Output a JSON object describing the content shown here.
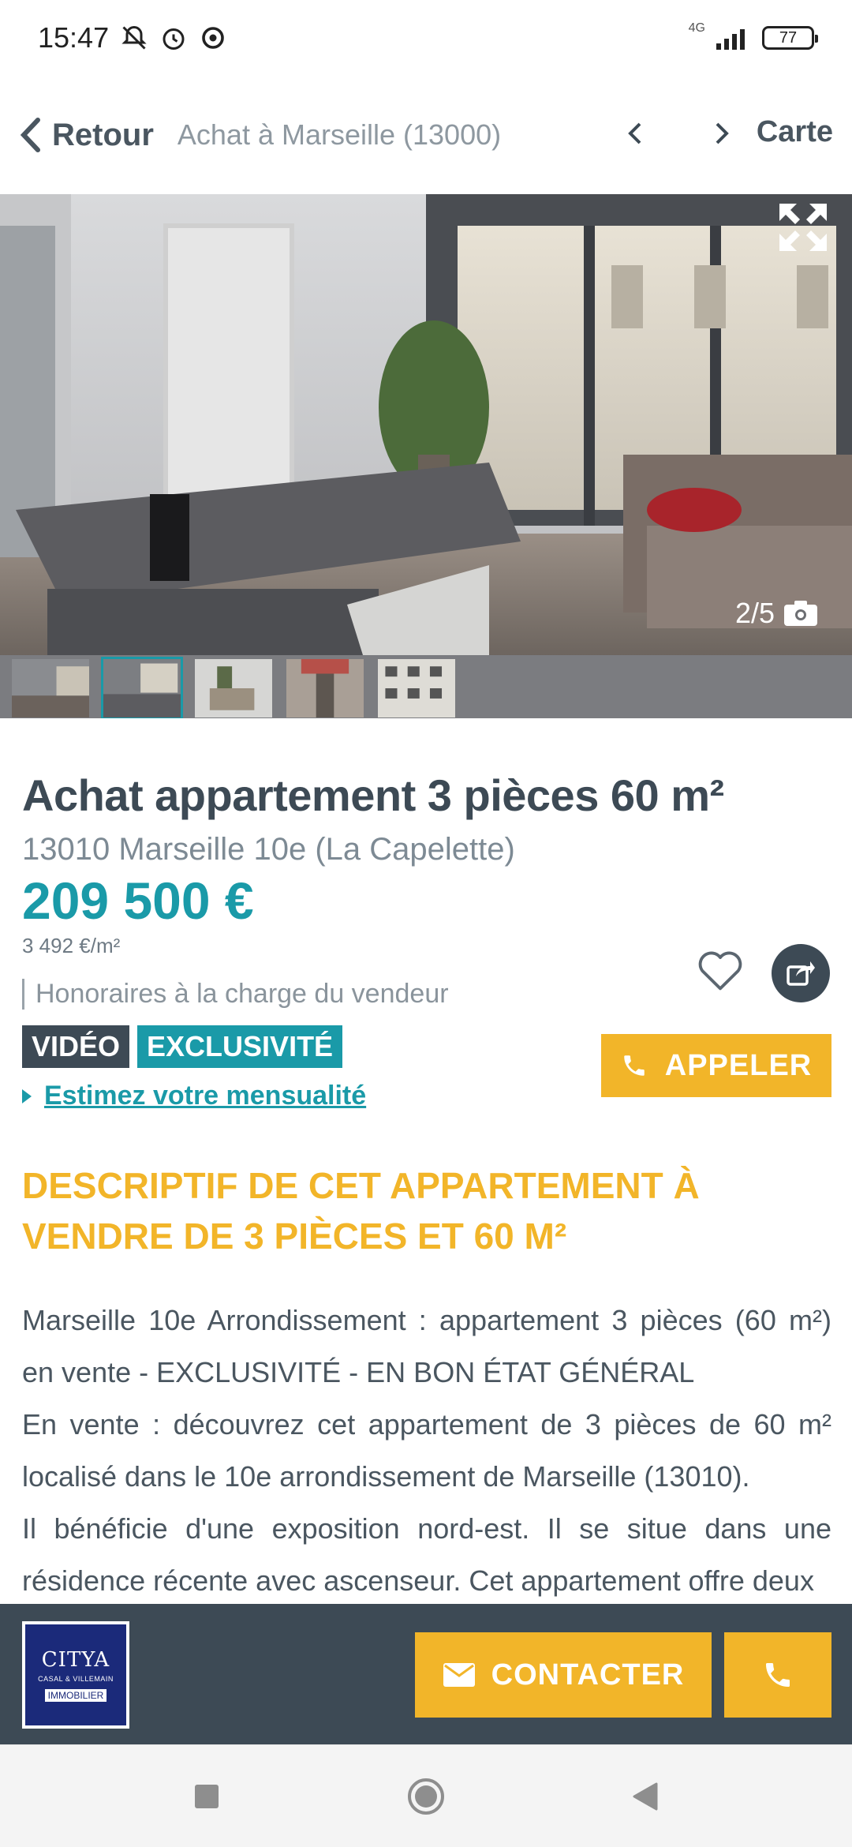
{
  "status_bar": {
    "time": "15:47",
    "network": "4G",
    "battery": "77",
    "icons": [
      "notifications-muted-icon",
      "alarm-icon",
      "chat-bubble-icon",
      "signal-icon",
      "battery-icon"
    ]
  },
  "nav": {
    "back_label": "Retour",
    "subtitle": "Achat à Marseille (13000)",
    "map_label": "Carte"
  },
  "gallery": {
    "counter": "2/5",
    "total_thumbs": 5,
    "active_thumb": 2
  },
  "listing": {
    "title": "Achat appartement 3 pièces 60 m²",
    "location": "13010 Marseille 10e (La Capelette)",
    "price": "209 500 €",
    "price_per_sqm": "3 492 €/m²",
    "fees": "Honoraires à la charge du vendeur",
    "badges": {
      "video": "VIDÉO",
      "exclusive": "EXCLUSIVITÉ"
    },
    "estimate_link": "Estimez votre mensualité",
    "call_label": "APPELER"
  },
  "description": {
    "heading": "DESCRIPTIF DE CET APPARTEMENT À VENDRE DE 3 PIÈCES ET 60 M²",
    "paragraphs": [
      "Marseille 10e Arrondissement : appartement 3 pièces (60 m²) en vente - EXCLUSIVITÉ - EN BON ÉTAT GÉNÉRAL",
      "En vente : découvrez cet appartement de 3 pièces de 60 m² localisé dans le 10e arrondissement de Marseille (13010).",
      "Il bénéficie d'une exposition nord-est. Il se situe dans une résidence récente avec ascenseur. Cet appartement offre deux"
    ]
  },
  "contact_bar": {
    "agency": {
      "name": "CITYA",
      "sub": "CASAL & VILLEMAIN",
      "foot": "IMMOBILIER"
    },
    "contact_label": "CONTACTER"
  },
  "colors": {
    "teal": "#1a9aa8",
    "yellow": "#f2b529",
    "slate": "#3d4a55"
  }
}
